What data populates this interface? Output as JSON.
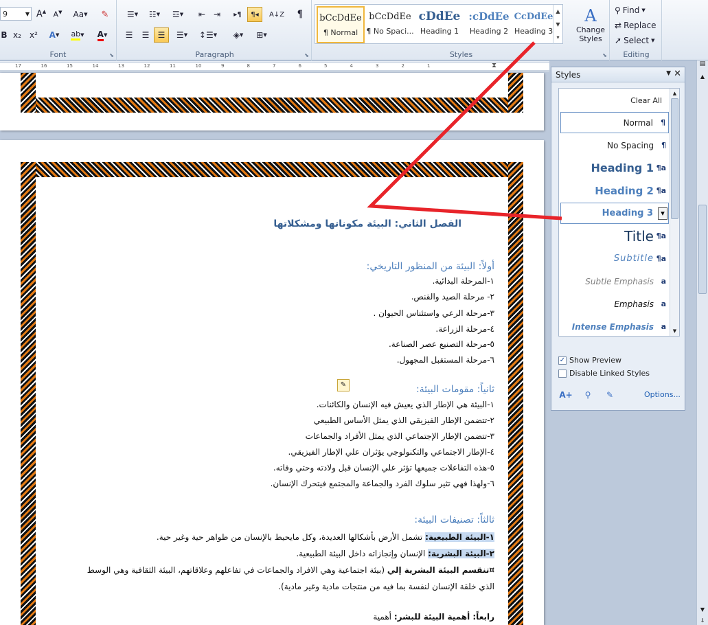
{
  "ribbon": {
    "font_size": "9",
    "font_group_label": "Font",
    "paragraph_group_label": "Paragraph",
    "styles_group_label": "Styles",
    "editing_group_label": "Editing",
    "change_case_label": "Aa",
    "bold_label": "B",
    "subscript_label": "x₂",
    "superscript_label": "x²",
    "find_label": "Find",
    "replace_label": "Replace",
    "select_label": "Select",
    "change_styles_label_1": "Change",
    "change_styles_label_2": "Styles",
    "gallery": [
      {
        "preview": "bCcDdEe",
        "name": "¶ Normal"
      },
      {
        "preview": "bCcDdEe",
        "name": "¶ No Spaci..."
      },
      {
        "preview": "cDdEe",
        "name": "Heading 1"
      },
      {
        "preview": ":cDdEe",
        "name": "Heading 2"
      },
      {
        "preview": "CcDdEe",
        "name": "Heading 3"
      }
    ]
  },
  "ruler": {
    "ticks": [
      "17",
      "16",
      "15",
      "14",
      "13",
      "12",
      "11",
      "10",
      "9",
      "8",
      "7",
      "6",
      "5",
      "4",
      "3",
      "2",
      "1"
    ]
  },
  "document": {
    "chapter_title": "الفصل الثاني: البيئة مكوناتها ومشكلاتها",
    "section1_title": "أولاً: البيئة من المنظور التاريخي:",
    "section1_items": [
      "١-المرحلة البدائية.",
      "٢- مرحلة الصيد والقنص.",
      "٣-مرحلة الرعي واستئناس الحيوان .",
      "٤-مرحلة الزراعة.",
      "٥-مرحلة التصنيع عصر الصناعة.",
      "٦-مرحلة المستقبل المجهول."
    ],
    "section2_title": "ثانياً: مقومات البيئة:",
    "section2_items": [
      "١-البيئة هي الإطار الذي يعيش فيه الإنسان والكائنات.",
      "٢-تتضمن الإطار الفيزيقي الذي يمثل الأساس الطبيعي",
      "٣-تتضمن الإطار الإجتماعي الذي يمثل الأفراد والجماعات",
      "٤-الإطار الاجتماعي والتكنولوجي يؤثران علي الإطار الفيزيقي.",
      "٥-هذه التفاعلات جميعها تؤثر علي الإنسان قبل ولادته وحتي وفاته.",
      "٦-ولهذا فهي تثير سلوك الفرد والجماعة والمجتمع فيتحرك الإنسان."
    ],
    "section3_title": "ثالثاً: تصنيفات البيئة:",
    "s3_line1_hl": "١-البيئة الطبيعية:",
    "s3_line1_rest": " تشمل الأرض بأشكالها العديدة، وكل مايحيط بالإنسان من ظواهر حية وغير حية.",
    "s3_line2_hl": "٢-البيئة البشرية:",
    "s3_line2_rest": " الإنسان وإنجازاته داخل البيئة الطبيعية.",
    "s3_line3_bold": "¤تنقسم البيئة البشرية إلي",
    "s3_line3_rest": " (بيئة اجتماعية وهي الافراد والجماعات في تفاعلهم وعلاقاتهم، البيئة الثقافية وهي الوسط",
    "s3_line4": "الذي خلقة الإنسان لنفسة بما فيه من منتجات مادية وغير مادية).",
    "section4_title": "رابعاً: أهمية البيئة للبشر:",
    "section4_rest": "أهمية"
  },
  "styles_pane": {
    "title": "Styles",
    "clear_all": "Clear All",
    "items": [
      {
        "name": "Normal",
        "glyph": "¶"
      },
      {
        "name": "No Spacing",
        "glyph": "¶"
      },
      {
        "name": "Heading 1",
        "glyph": "¶a"
      },
      {
        "name": "Heading 2",
        "glyph": "¶a"
      },
      {
        "name": "Heading 3",
        "glyph": "▾"
      },
      {
        "name": "Title",
        "glyph": "¶a"
      },
      {
        "name": "Subtitle",
        "glyph": "¶a"
      },
      {
        "name": "Subtle Emphasis",
        "glyph": "a"
      },
      {
        "name": "Emphasis",
        "glyph": "a"
      },
      {
        "name": "Intense Emphasis",
        "glyph": "a"
      }
    ],
    "show_preview": "Show Preview",
    "disable_linked": "Disable Linked Styles",
    "options": "Options..."
  }
}
